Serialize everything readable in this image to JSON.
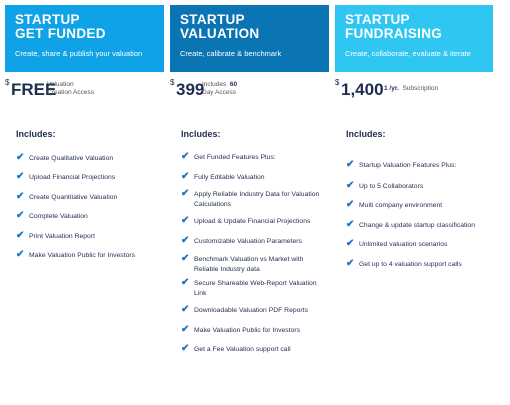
{
  "plans": [
    {
      "name_line1": "STARTUP",
      "name_line2": "GET FUNDED",
      "tagline": "Create, share & publish your valuation",
      "price_symbol": "$",
      "price": "FREE",
      "price_note_line1": "Valuation",
      "price_note_line2": "Creation Access",
      "includes_label": "Includes:",
      "features": [
        "Create Qualitative Valuation",
        "Upload Financial Projections",
        "Create Quantitative Valuation",
        "Complete Valuation",
        "Print Valuation Report",
        "Make Valuation Public for Investors"
      ]
    },
    {
      "name_line1": "STARTUP",
      "name_line2": "VALUATION",
      "tagline": "Create, calibrate & benchmark",
      "price_symbol": "$",
      "price": "399",
      "price_note_line1": "Includes",
      "price_note_bold": "60",
      "price_note_line2": "Day Access",
      "includes_label": "Includes:",
      "features": [
        "Get Funded Features Plus:",
        "Fully Editable Valuation",
        "Apply Reliable Industry Data for Valuation Calculations",
        "Upload & Update Financial Projections",
        "Customizable Valuation Parameters",
        "Benchmark Valuation vs Market with Reliable Industry data",
        "Secure Shareable Web-Report Valuation Link",
        "Downloadable Valuation PDF Reports",
        "Make Valuation Public for Investors",
        "Get a Fee Valuation support call"
      ]
    },
    {
      "name_line1": "STARTUP",
      "name_line2": "FUNDRAISING",
      "tagline": "Create, collaborate, evaluate & iterate",
      "price_symbol": "$",
      "price": "1,400",
      "price_note_bold": "1 /yr.",
      "price_note_line1": "Subscription",
      "includes_label": "Includes:",
      "features": [
        "Startup Valuation Features Plus:",
        "Up to 5 Collaborators",
        "Multi company environment",
        "Change & update startup classification",
        "Unlimited valuation scenarios",
        "Get up to 4 valuation support calls"
      ]
    }
  ],
  "colors": {
    "plan1": "#10a2e6",
    "plan2": "#0b74b3",
    "plan3": "#2fc6f2",
    "check": "#1f75c8"
  },
  "icons": {
    "feature_bullet": "checkmark-icon"
  }
}
